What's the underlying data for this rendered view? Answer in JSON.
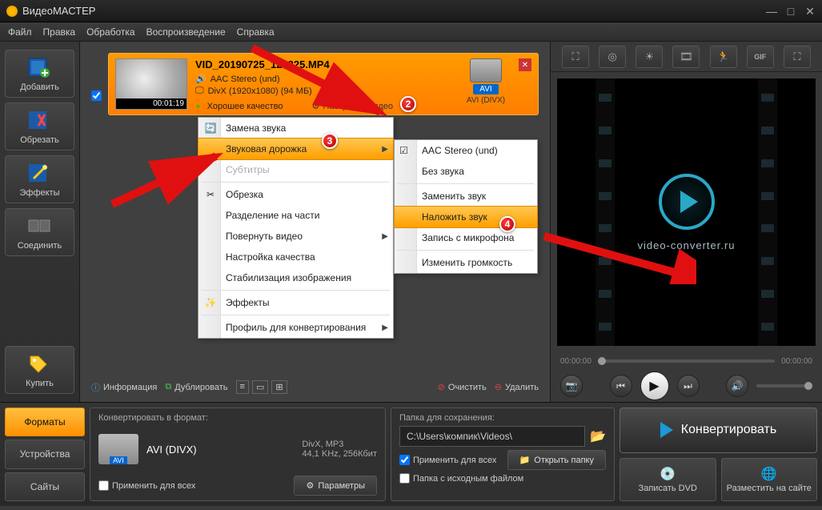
{
  "title": "ВидеоМАСТЕР",
  "menubar": [
    "Файл",
    "Правка",
    "Обработка",
    "Воспроизведение",
    "Справка"
  ],
  "left_toolbar": [
    {
      "name": "add",
      "label": "Добавить"
    },
    {
      "name": "cut",
      "label": "Обрезать"
    },
    {
      "name": "effects",
      "label": "Эффекты"
    },
    {
      "name": "join",
      "label": "Соединить"
    },
    {
      "name": "buy",
      "label": "Купить"
    }
  ],
  "file": {
    "name": "VID_20190725_123325.MP4",
    "audio": "AAC Stereo (und)",
    "video": "DivX (1920x1080) (94 МБ)",
    "duration": "00:01:19",
    "quality": "Хорошее качество",
    "settings_link": "Настройки видео",
    "avi_label": "AVI",
    "avi_sub": "AVI (DIVX)"
  },
  "context_menu": {
    "items": [
      {
        "label": "Замена звука",
        "icon": "sound-swap"
      },
      {
        "label": "Звуковая дорожка",
        "icon": "",
        "hl": true,
        "arrow": true
      },
      {
        "label": "Субтитры",
        "disabled": true
      },
      {
        "label": "Обрезка",
        "icon": "scissors"
      },
      {
        "label": "Разделение на части"
      },
      {
        "label": "Повернуть видео",
        "arrow": true
      },
      {
        "label": "Настройка качества"
      },
      {
        "label": "Стабилизация изображения"
      },
      {
        "label": "Эффекты",
        "icon": "fx"
      },
      {
        "label": "Профиль для конвертирования",
        "arrow": true
      }
    ]
  },
  "submenu": {
    "items": [
      {
        "label": "AAC Stereo (und)",
        "checked": true
      },
      {
        "label": "Без звука"
      },
      {
        "label": "Заменить звук"
      },
      {
        "label": "Наложить звук",
        "hl": true
      },
      {
        "label": "Запись с микрофона"
      },
      {
        "label": "Изменить громкость"
      }
    ]
  },
  "bottom_strip": {
    "info": "Информация",
    "duplicate": "Дублировать",
    "clear": "Очистить",
    "delete": "Удалить"
  },
  "preview": {
    "link": "video-converter.ru",
    "time_start": "00:00:00",
    "time_end": "00:00:00"
  },
  "footer": {
    "tabs": [
      "Форматы",
      "Устройства",
      "Сайты"
    ],
    "convert_to": "Конвертировать в формат:",
    "format_name": "AVI (DIVX)",
    "format_codec": "DivX, MP3",
    "format_rate": "44,1 KHz, 256Кбит",
    "apply_all": "Применить для всех",
    "params": "Параметры",
    "save_folder": "Папка для сохранения:",
    "path": "C:\\Users\\компик\\Videos\\",
    "apply_all2": "Применить для всех",
    "src_folder": "Папка с исходным файлом",
    "open_folder": "Открыть папку",
    "convert": "Конвертировать",
    "burn_dvd": "Записать DVD",
    "upload": "Разместить на сайте"
  }
}
